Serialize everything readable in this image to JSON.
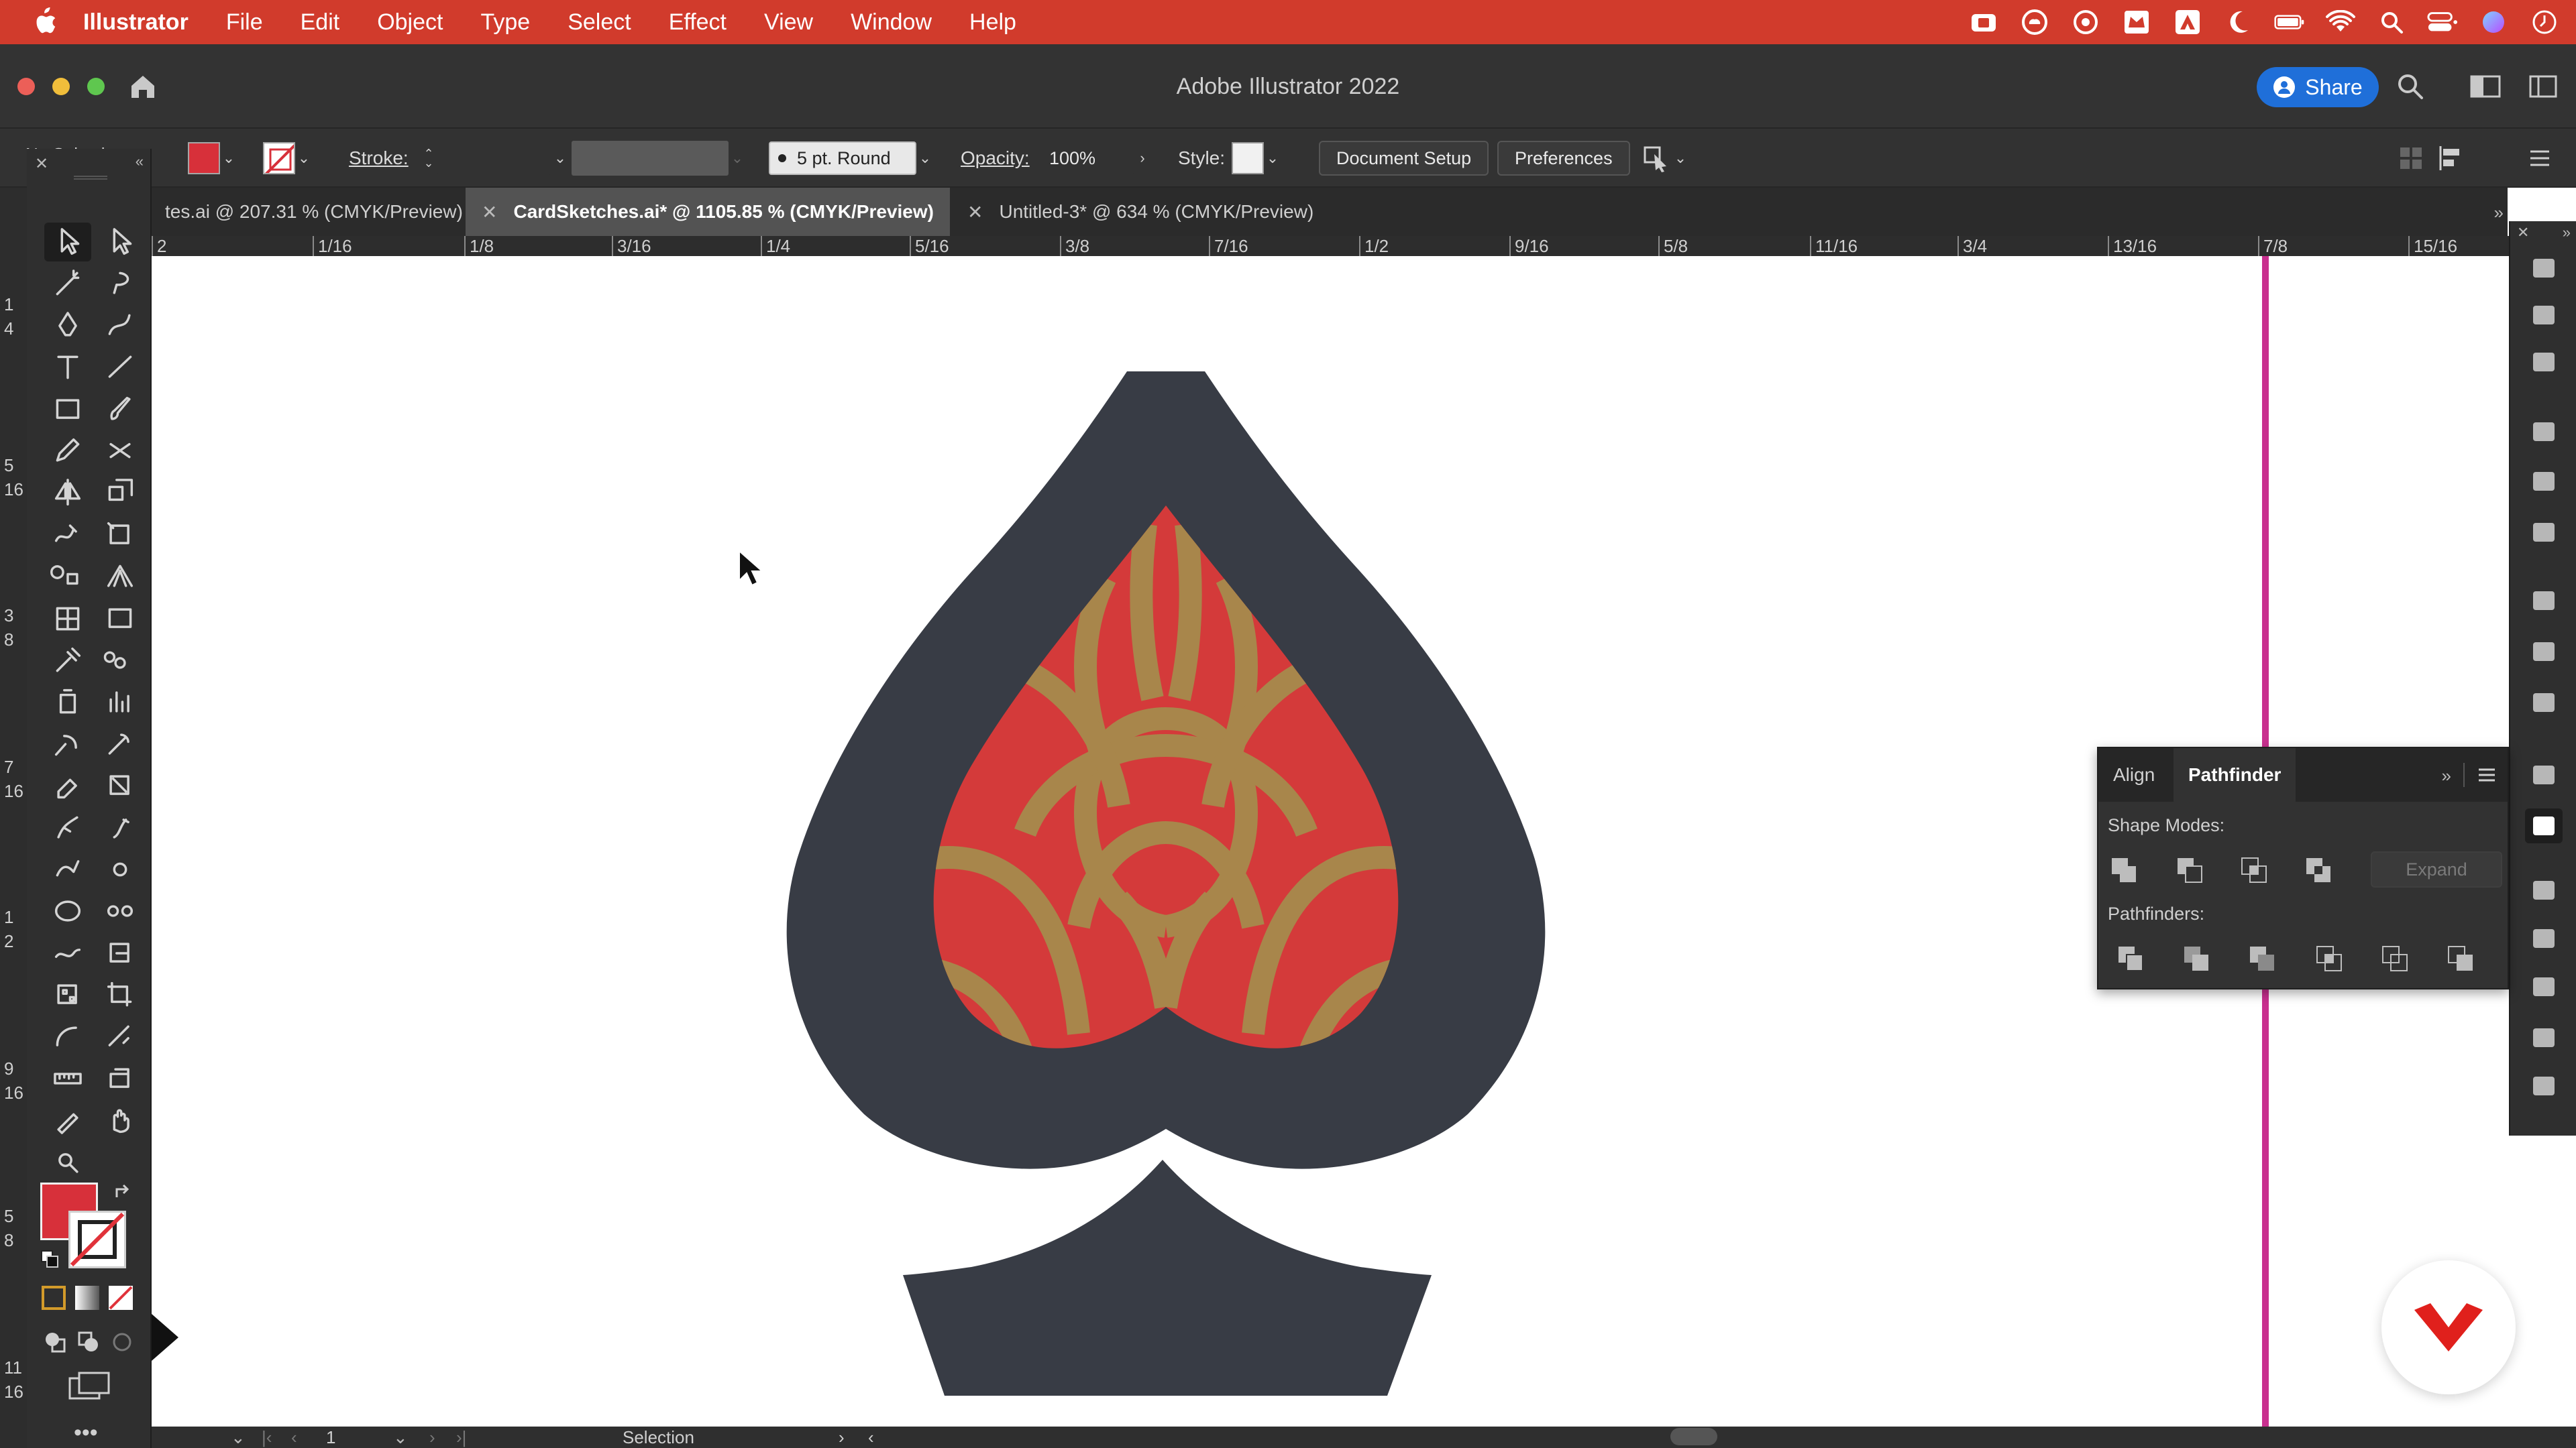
{
  "menubar": {
    "app_name": "Illustrator",
    "items": [
      "File",
      "Edit",
      "Object",
      "Type",
      "Select",
      "Effect",
      "View",
      "Window",
      "Help"
    ],
    "status_icons": [
      "camera-icon",
      "creative-cloud-icon",
      "sync-icon",
      "crown-icon",
      "adobe-icon",
      "moon-icon",
      "battery-icon",
      "wifi-icon",
      "spotlight-search-icon",
      "control-center-icon",
      "siri-icon",
      "clock-icon"
    ]
  },
  "window": {
    "title": "Adobe Illustrator 2022",
    "share_label": "Share"
  },
  "controlbar": {
    "selection_label": "No Selection",
    "stroke_label": "Stroke:",
    "brush_label": "5 pt. Round",
    "opacity_label": "Opacity:",
    "opacity_value": "100%",
    "style_label": "Style:",
    "document_setup_label": "Document Setup",
    "preferences_label": "Preferences"
  },
  "tabs": [
    {
      "label": "tes.ai @ 207.31 % (CMYK/Preview)",
      "active": false
    },
    {
      "label": "CardSketches.ai* @ 1105.85 % (CMYK/Preview)",
      "active": true
    },
    {
      "label": "Untitled-3* @ 634 % (CMYK/Preview)",
      "active": false
    }
  ],
  "ruler_top": [
    "2",
    "1/16",
    "1/8",
    "3/16",
    "1/4",
    "5/16",
    "3/8",
    "7/16",
    "1/2",
    "9/16",
    "5/8",
    "11/16",
    "3/4",
    "13/16",
    "7/8",
    "15/16"
  ],
  "ruler_left": [
    "1",
    "4",
    "5",
    "16",
    "3",
    "8",
    "7",
    "16",
    "1",
    "2",
    "9",
    "16",
    "5",
    "8",
    "11",
    "16"
  ],
  "pathfinder": {
    "tab_align": "Align",
    "tab_pathfinder": "Pathfinder",
    "shape_modes_label": "Shape Modes:",
    "pathfinders_label": "Pathfinders:",
    "expand_label": "Expand"
  },
  "statusbar": {
    "artboard_number": "1",
    "tool_name": "Selection"
  },
  "colors": {
    "menubar": "#d13b2c",
    "spade_dark": "#383c45",
    "spade_red": "#d43a3a",
    "spade_gold": "#a8864b",
    "fill_swatch": "#d7303a",
    "guide": "#c9308f",
    "share_blue": "#1f6fd9"
  }
}
